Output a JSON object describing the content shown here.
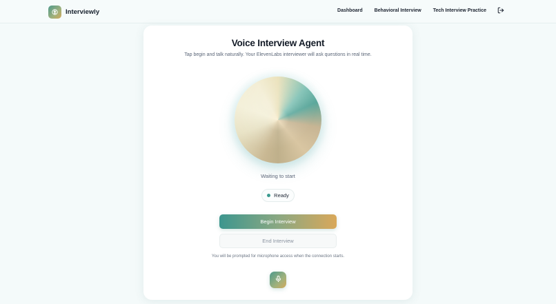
{
  "header": {
    "brand_name": "Interviewly",
    "nav": [
      {
        "label": "Dashboard"
      },
      {
        "label": "Behavioral Interview"
      },
      {
        "label": "Tech Interview Practice"
      }
    ],
    "logout_icon": "logout-icon"
  },
  "main": {
    "title": "Voice Interview Agent",
    "subtitle": "Tap begin and talk naturally. Your ElevenLabs interviewer will ask questions in real time.",
    "status_text": "Waiting to start",
    "ready_label": "Ready",
    "begin_label": "Begin Interview",
    "end_label": "End Interview",
    "hint": "You will be prompted for microphone access when the connection starts.",
    "mic_icon": "microphone-icon"
  },
  "colors": {
    "accent_teal": "#3d968e",
    "accent_gold": "#d9a85a",
    "ready_dot": "#3a9a8f",
    "background": "#f4fafa"
  }
}
